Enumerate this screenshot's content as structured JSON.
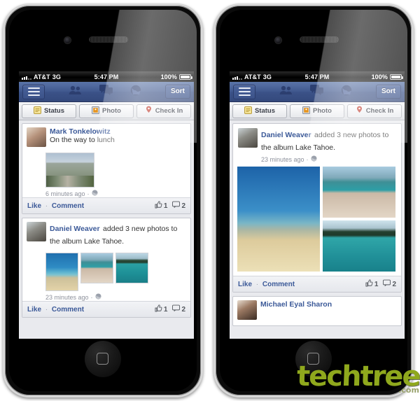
{
  "meta": {
    "watermark": "techtree",
    "watermark_suffix": ".com",
    "accent_blue": "#3b5998",
    "navbar_blue": "#3b5288",
    "feed_bg": "#e9eaee"
  },
  "status_bar": {
    "carrier": "AT&T",
    "network": "3G",
    "time": "5:47 PM",
    "battery_percent": "100%"
  },
  "navbar": {
    "menu_icon": "hamburger-icon",
    "icons": [
      "friends-icon",
      "messages-icon",
      "globe-icon"
    ],
    "sort_label": "Sort"
  },
  "composer": {
    "buttons": [
      {
        "label": "Status",
        "icon": "status-note-icon"
      },
      {
        "label": "Photo",
        "icon": "photo-icon"
      },
      {
        "label": "Check In",
        "icon": "map-pin-icon"
      }
    ]
  },
  "footer_actions": {
    "like_label": "Like",
    "separator": "·",
    "comment_label": "Comment",
    "like_count": "1",
    "comment_count": "2"
  },
  "phone_left": {
    "stories": [
      {
        "author": "Mark Tonkelowitz",
        "message": "On the way to lunch",
        "timestamp": "6 minutes ago",
        "privacy_icon": "globe-icon",
        "attachment": "single-photo",
        "like_count": "1",
        "comment_count": "2"
      },
      {
        "author": "Daniel Weaver",
        "message": "added 3 new photos to the album Lake Tahoe.",
        "timestamp": "23 minutes ago",
        "privacy_icon": "globe-icon",
        "attachment": "three-thumbnails",
        "like_count": "1",
        "comment_count": "2"
      }
    ]
  },
  "phone_right": {
    "stories": [
      {
        "author": "Daniel Weaver",
        "message": "added 3 new photos to the album Lake Tahoe.",
        "timestamp": "23 minutes ago",
        "privacy_icon": "globe-icon",
        "attachment": "photo-collage",
        "like_count": "1",
        "comment_count": "2"
      }
    ],
    "next_story_author": "Michael Eyal Sharon"
  }
}
